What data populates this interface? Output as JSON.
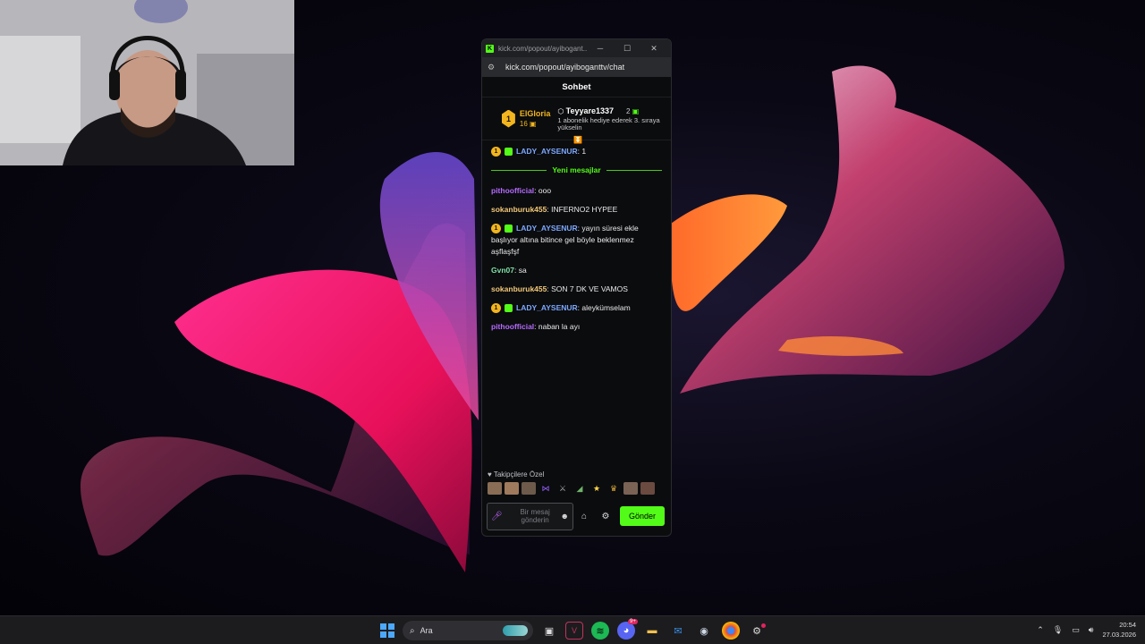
{
  "popout": {
    "window_title": "kick.com/popout/ayibogant...",
    "address": "kick.com/popout/ayiboganttv/chat",
    "chat_title": "Sohbet",
    "pinned": {
      "rank": "1",
      "user1": "ElGloria",
      "count1": "16",
      "user2": "Teyyare1337",
      "count2": "2",
      "gift_text": "1 abonelik hediye ederek 3. sıraya yükselin"
    },
    "messages": [
      {
        "badge": "1",
        "user": "LADY_AYSENUR",
        "text": ": 1",
        "color": "#7da8ff"
      },
      {
        "user": "pithoofficial",
        "text": ": ooo",
        "color": "#b56bff"
      },
      {
        "user": "sokanburuk455",
        "text": ": INFERNO2 HYPEE",
        "color": "#f2c979"
      },
      {
        "badge": "1",
        "user": "LADY_AYSENUR",
        "text": ": yayın süresi ekle başlıyor altına bitince gel böyle beklenmez aşflaşfşf",
        "color": "#7da8ff"
      },
      {
        "user": "Gvn07",
        "text": ": sa",
        "color": "#7fe0a8"
      },
      {
        "user": "sokanburuk455",
        "text": ": SON 7 DK VE VAMOS",
        "color": "#f2c979"
      },
      {
        "badge": "1",
        "user": "LADY_AYSENUR",
        "text": ": aleykümselam",
        "color": "#7da8ff"
      },
      {
        "user": "pithoofficial",
        "text": ": naban la ayı",
        "color": "#b56bff"
      }
    ],
    "new_messages_label": "Yeni mesajlar",
    "followers_label": "Takipçilere Özel",
    "input_placeholder": "Bir mesaj gönderin",
    "send_label": "Gönder"
  },
  "taskbar": {
    "search_placeholder": "Ara",
    "discord_badge": "9+",
    "time": "20:54",
    "date": "27.03.2026"
  },
  "colors": {
    "kick_green": "#53fc18",
    "gold": "#f2b51f"
  }
}
